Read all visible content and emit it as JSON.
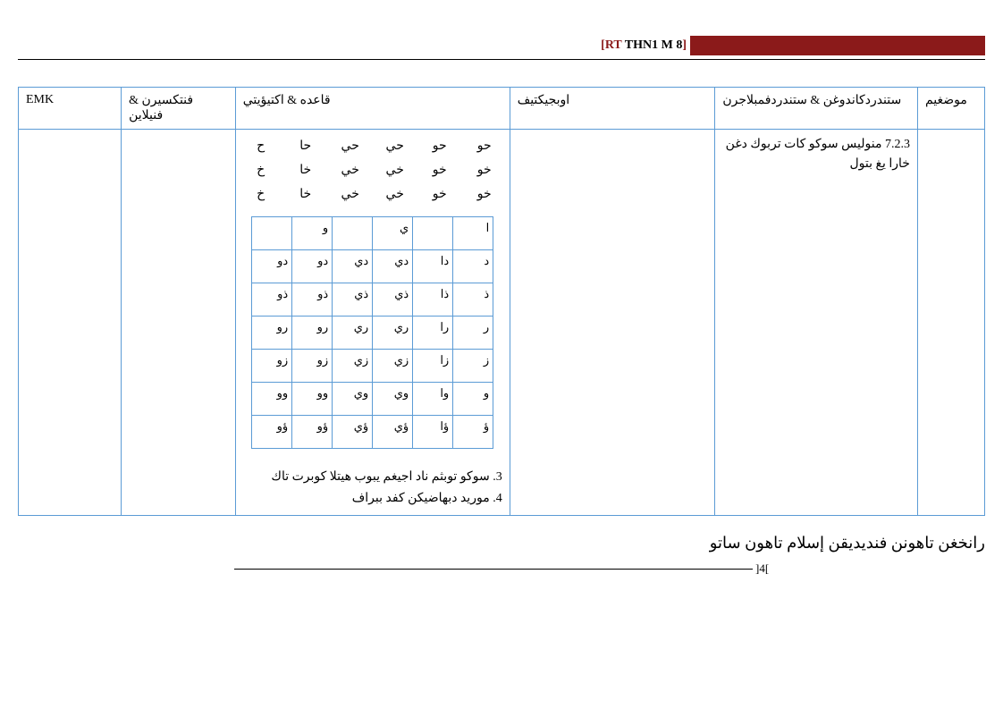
{
  "header": {
    "rt_label_open": "[",
    "rt_label_rt": "RT",
    "rt_label_rest": " THN1 M 8",
    "rt_label_close": "]"
  },
  "table": {
    "headers": {
      "maudu": "موضغيم",
      "std": "ستندردكاندوغن & ستندردفمبلاجرن",
      "obj": "اوبجيكتيف",
      "akt": "قاعده & اكتيؤيتي",
      "pen": "فنتكسيرن & فنيلاين",
      "emk": "EMK"
    },
    "row": {
      "std": "7.2.3 منوليس سوكو كات تربوك دغن خارا يغ بتول",
      "gridRows": [
        [
          "حو",
          "حو",
          "حي",
          "حي",
          "حا",
          "ح"
        ],
        [
          "خو",
          "خو",
          "خي",
          "خي",
          "خا",
          "خ"
        ],
        [
          "خو",
          "خو",
          "خي",
          "خي",
          "خا",
          "خ"
        ]
      ],
      "innerTable": [
        [
          "ا",
          "",
          "ي",
          "",
          "و",
          ""
        ],
        [
          "د",
          "دا",
          "دي",
          "دي",
          "دو",
          "دو"
        ],
        [
          "ذ",
          "ذا",
          "ذي",
          "ذي",
          "ذو",
          "ذو"
        ],
        [
          "ر",
          "را",
          "ري",
          "ري",
          "رو",
          "رو"
        ],
        [
          "ز",
          "زا",
          "زي",
          "زي",
          "زو",
          "زو"
        ],
        [
          "و",
          "وا",
          "وي",
          "وي",
          "وو",
          "وو"
        ],
        [
          "ؤ",
          "ؤا",
          "ؤي",
          "ؤي",
          "ؤو",
          "ؤو"
        ]
      ],
      "act3": "3. سوكو توبثم ناد اجيغم يبوب هيتلا كوبرت تاك",
      "act4": "4. موريد  دبهاضيكن كفد ببراف"
    }
  },
  "footer": {
    "line": "رانخغن تاهونن فنديديقن إسلام تاهون ساتو",
    "page_open": "]",
    "page_num": "4",
    "page_close": "["
  }
}
